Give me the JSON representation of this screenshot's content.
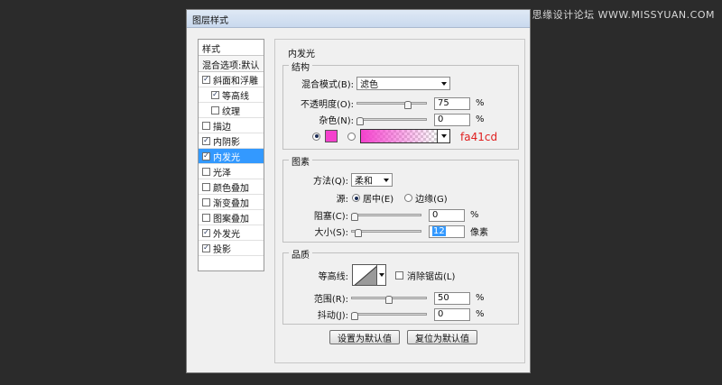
{
  "watermark": "思缘设计论坛 WWW.MISSYUAN.COM",
  "dialog_title": "图层样式",
  "style_list": {
    "header": "样式",
    "blend": "混合选项:默认",
    "items": [
      {
        "label": "斜面和浮雕",
        "checked": true,
        "indent": false,
        "selected": false
      },
      {
        "label": "等高线",
        "checked": true,
        "indent": true,
        "selected": false
      },
      {
        "label": "纹理",
        "checked": false,
        "indent": true,
        "selected": false
      },
      {
        "label": "描边",
        "checked": false,
        "indent": false,
        "selected": false
      },
      {
        "label": "内阴影",
        "checked": true,
        "indent": false,
        "selected": false
      },
      {
        "label": "内发光",
        "checked": true,
        "indent": false,
        "selected": true
      },
      {
        "label": "光泽",
        "checked": false,
        "indent": false,
        "selected": false
      },
      {
        "label": "颜色叠加",
        "checked": false,
        "indent": false,
        "selected": false
      },
      {
        "label": "渐变叠加",
        "checked": false,
        "indent": false,
        "selected": false
      },
      {
        "label": "图案叠加",
        "checked": false,
        "indent": false,
        "selected": false
      },
      {
        "label": "外发光",
        "checked": true,
        "indent": false,
        "selected": false
      },
      {
        "label": "投影",
        "checked": true,
        "indent": false,
        "selected": false
      }
    ]
  },
  "panel_title": "内发光",
  "structure": {
    "title": "结构",
    "blend_mode_label": "混合模式(B):",
    "blend_mode_value": "滤色",
    "opacity_label": "不透明度(O):",
    "opacity_value": "75",
    "opacity_fraction": 0.75,
    "noise_label": "杂色(N):",
    "noise_value": "0",
    "noise_fraction": 0,
    "percent": "%",
    "color_hex": "#f441cd",
    "color_note": "fa41cd"
  },
  "elements": {
    "title": "图素",
    "technique_label": "方法(Q):",
    "technique_value": "柔和",
    "source_label": "源:",
    "source_center": "居中(E)",
    "source_edge": "边缘(G)",
    "choke_label": "阻塞(C):",
    "choke_value": "0",
    "choke_fraction": 0,
    "size_label": "大小(S):",
    "size_value": "12",
    "size_fraction": 0.05,
    "size_unit": "像素"
  },
  "quality": {
    "title": "品质",
    "contour_label": "等高线:",
    "antialias_label": "消除锯齿(L)",
    "range_label": "范围(R):",
    "range_value": "50",
    "range_fraction": 0.5,
    "jitter_label": "抖动(J):",
    "jitter_value": "0",
    "jitter_fraction": 0
  },
  "buttons": {
    "make_default": "设置为默认值",
    "reset_default": "复位为默认值"
  }
}
